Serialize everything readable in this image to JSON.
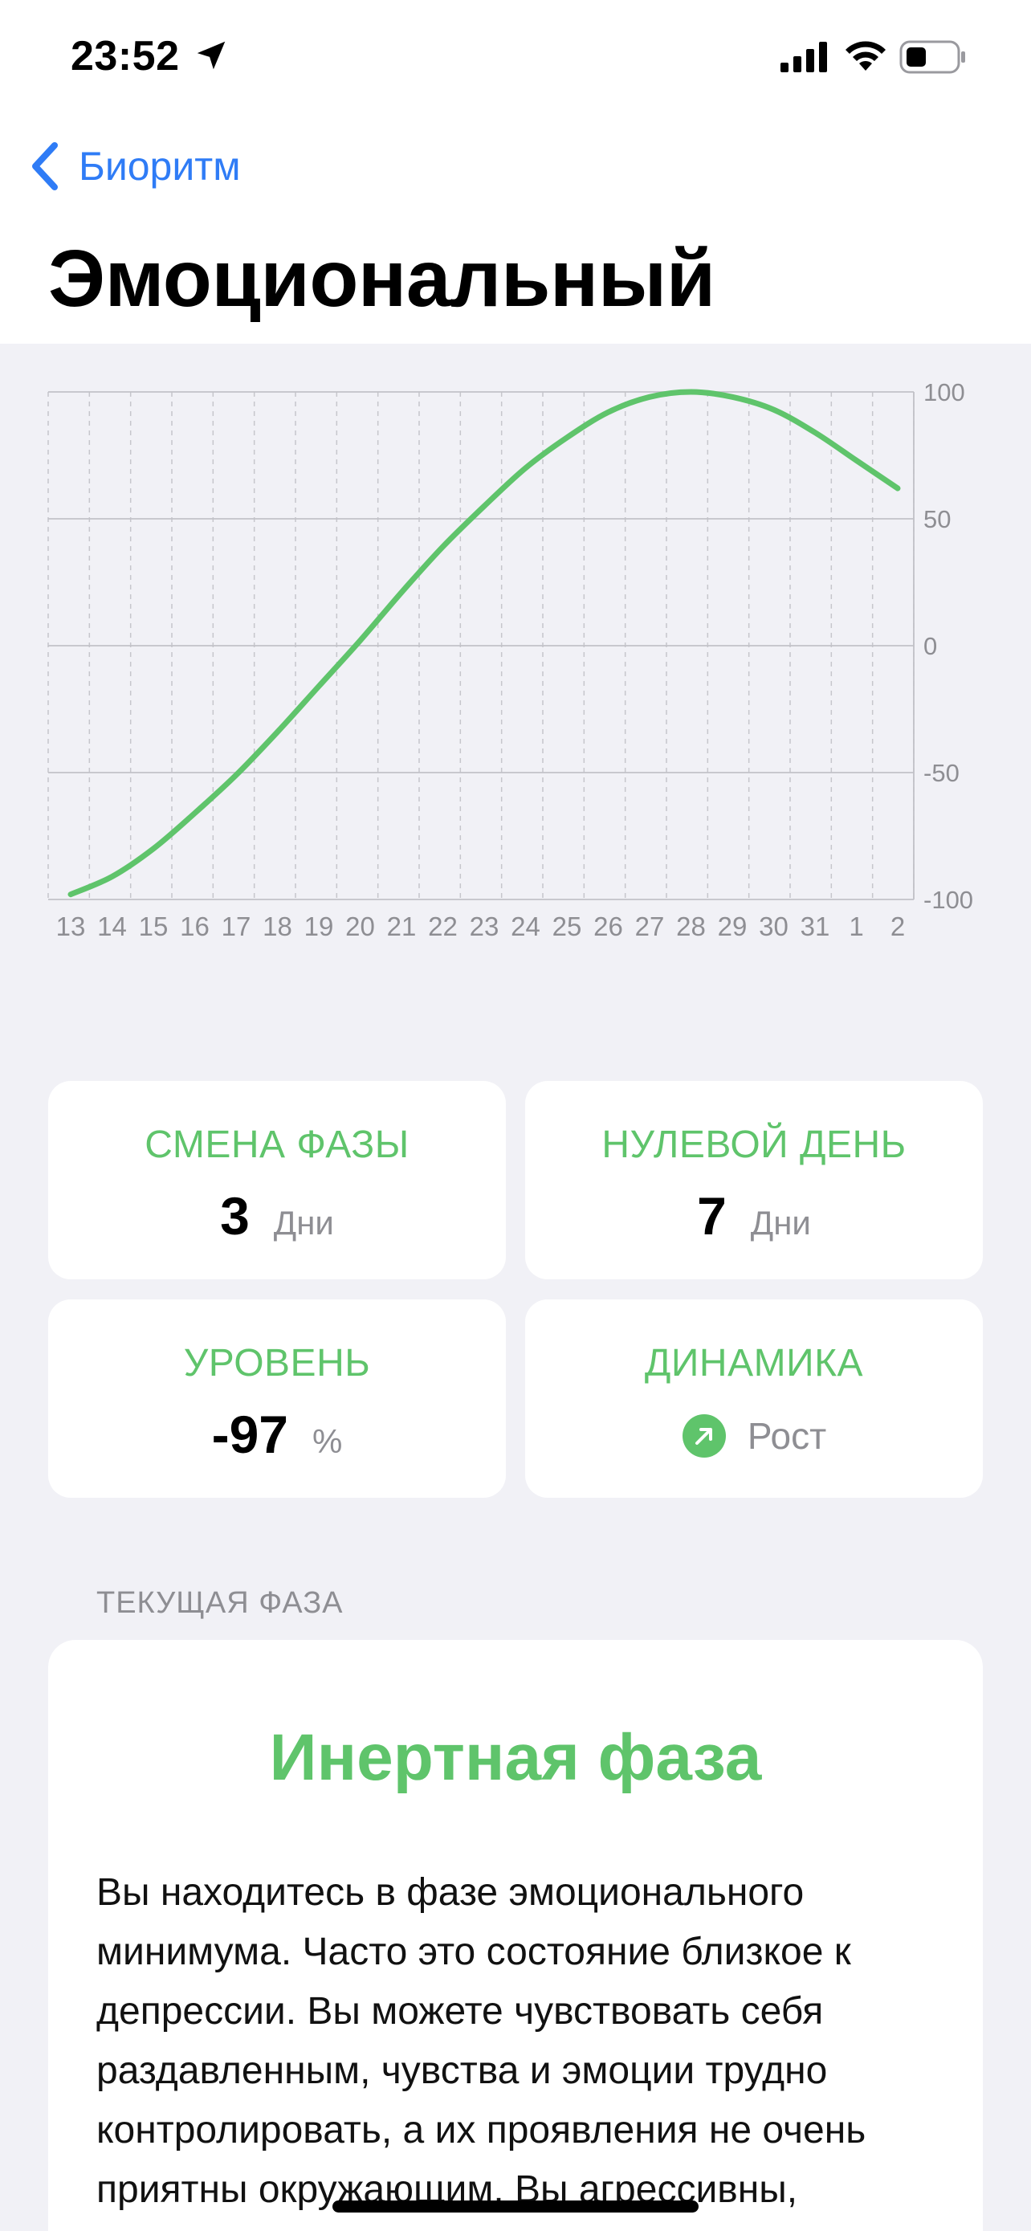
{
  "status_bar": {
    "time": "23:52",
    "icons": [
      "location-arrow-icon",
      "cellular-signal-icon",
      "wifi-icon",
      "battery-icon"
    ]
  },
  "nav": {
    "back_label": "Биоритм",
    "title": "Эмоциональный"
  },
  "colors": {
    "accent_blue": "#2f7cf6",
    "accent_green": "#5fc46b",
    "background": "#f1f1f6",
    "card": "#ffffff",
    "secondary_text": "#8e8e93"
  },
  "chart_data": {
    "type": "line",
    "x": [
      "13",
      "14",
      "15",
      "16",
      "17",
      "18",
      "19",
      "20",
      "21",
      "22",
      "23",
      "24",
      "25",
      "26",
      "27",
      "28",
      "29",
      "30",
      "31",
      "1",
      "2"
    ],
    "series": [
      {
        "values": [
          -98,
          -91,
          -80,
          -66,
          -51,
          -34,
          -16,
          2,
          21,
          39,
          55,
          70,
          82,
          92,
          98,
          100,
          98,
          93,
          84,
          73,
          62
        ],
        "color": "#5fc46b"
      }
    ],
    "y_ticks": [
      "100",
      "50",
      "0",
      "-50",
      "-100"
    ],
    "ylim": [
      -100,
      100
    ],
    "grid": true,
    "y_axis_position": "right"
  },
  "stats": {
    "phase_change": {
      "label": "СМЕНА ФАЗЫ",
      "value": "3",
      "unit": "Дни"
    },
    "zero_day": {
      "label": "НУЛЕВОЙ ДЕНЬ",
      "value": "7",
      "unit": "Дни"
    },
    "level": {
      "label": "УРОВЕНЬ",
      "value": "-97",
      "unit": "%"
    },
    "dynamics": {
      "label": "ДИНАМИКА",
      "value": "Рост",
      "icon": "arrow-up-right-icon"
    }
  },
  "current_phase": {
    "section_label": "ТЕКУЩАЯ ФАЗА",
    "title": "Инертная фаза",
    "description": "Вы находитесь в фазе эмоционального минимума. Часто это состояние близкое к депрессии. Вы можете чувствовать себя раздавленным, чувства и эмоции трудно контролировать, а их проявления не очень приятны окружающим. Вы агрессивны,"
  }
}
